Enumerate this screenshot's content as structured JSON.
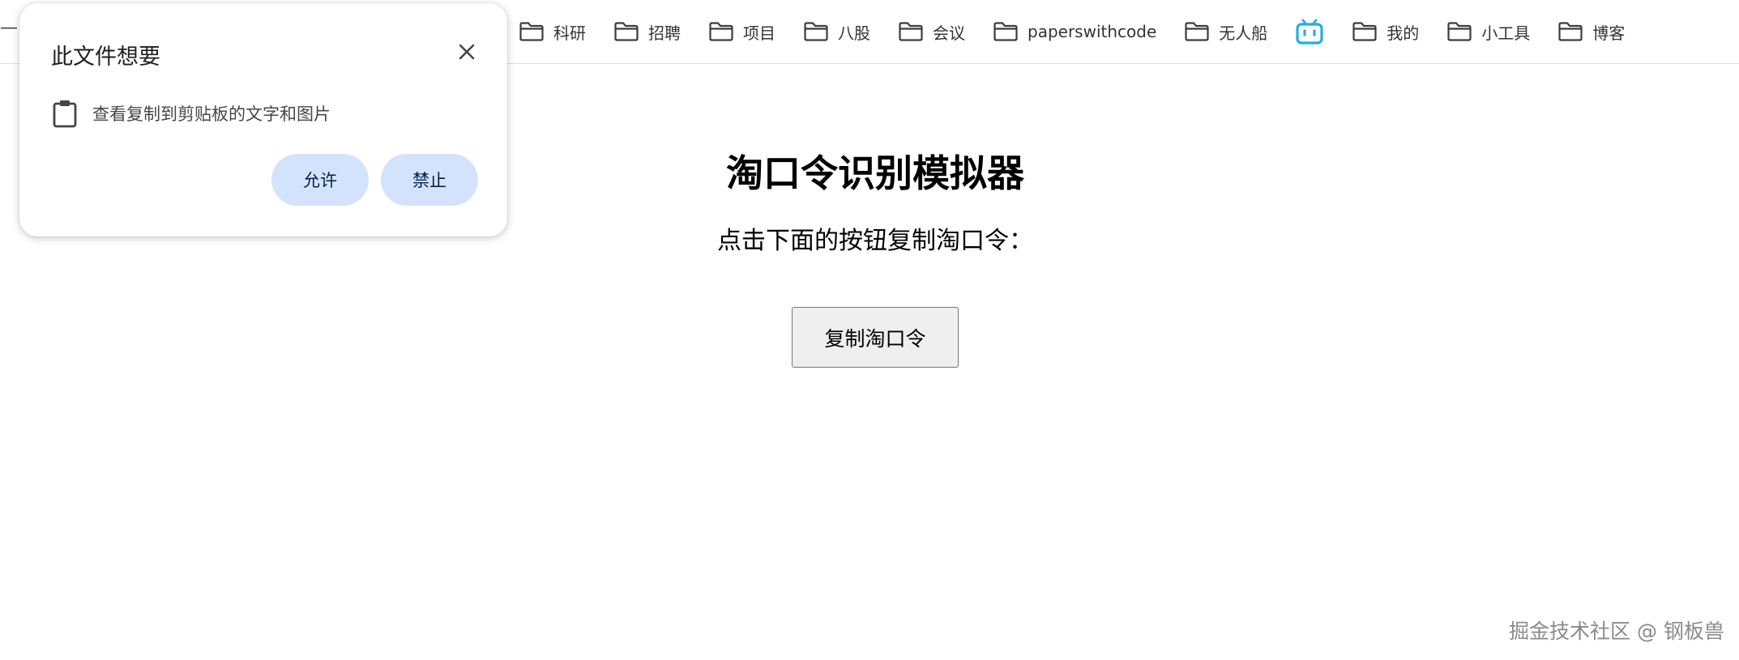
{
  "bookmarks_bar": {
    "leading_dash": "—",
    "items": [
      {
        "label": "科研",
        "icon": "folder-icon"
      },
      {
        "label": "招聘",
        "icon": "folder-icon"
      },
      {
        "label": "项目",
        "icon": "folder-icon"
      },
      {
        "label": "八股",
        "icon": "folder-icon"
      },
      {
        "label": "会议",
        "icon": "folder-icon"
      },
      {
        "label": "paperswithcode",
        "icon": "folder-icon"
      },
      {
        "label": "无人船",
        "icon": "folder-icon"
      },
      {
        "label": "",
        "icon": "bilibili-icon"
      },
      {
        "label": "我的",
        "icon": "folder-icon"
      },
      {
        "label": "小工具",
        "icon": "folder-icon"
      },
      {
        "label": "博客",
        "icon": "folder-icon"
      }
    ]
  },
  "permission_popup": {
    "title": "此文件想要",
    "permission_text": "查看复制到剪贴板的文字和图片",
    "permission_icon": "clipboard-icon",
    "allow_label": "允许",
    "deny_label": "禁止",
    "close_icon": "close-icon",
    "button_color": "#d3e3fd"
  },
  "main": {
    "title": "淘口令识别模拟器",
    "instruction": "点击下面的按钮复制淘口令：",
    "copy_button_label": "复制淘口令"
  },
  "watermark": {
    "text": "掘金技术社区 @ 钢板兽"
  },
  "colors": {
    "bilibili": "#23ade5"
  }
}
